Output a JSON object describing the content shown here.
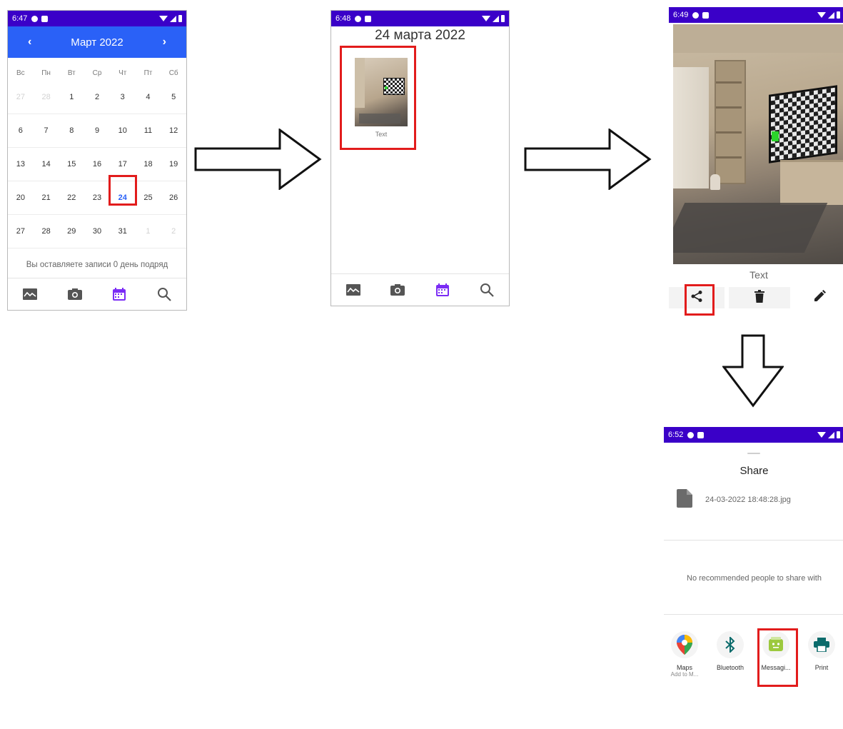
{
  "screen1": {
    "status_time": "6:47",
    "month_title": "Март  2022",
    "prev_arrow": "‹",
    "next_arrow": "›",
    "weekdays": [
      "Вс",
      "Пн",
      "Вт",
      "Ср",
      "Чт",
      "Пт",
      "Сб"
    ],
    "weeks": [
      [
        "27",
        "28",
        "1",
        "2",
        "3",
        "4",
        "5"
      ],
      [
        "6",
        "7",
        "8",
        "9",
        "10",
        "11",
        "12"
      ],
      [
        "13",
        "14",
        "15",
        "16",
        "17",
        "18",
        "19"
      ],
      [
        "20",
        "21",
        "22",
        "23",
        "24",
        "25",
        "26"
      ],
      [
        "27",
        "28",
        "29",
        "30",
        "31",
        "1",
        "2"
      ]
    ],
    "selected_day": "24",
    "streak_text": "Вы оставляете записи 0 день подряд"
  },
  "screen2": {
    "status_time": "6:48",
    "date_title": "24 марта 2022",
    "entry_caption": "Text"
  },
  "screen3": {
    "status_time": "6:49",
    "caption": "Text"
  },
  "screen4": {
    "status_time": "6:52",
    "title": "Share",
    "file_name": "24-03-2022 18:48:28.jpg",
    "no_people_text": "No recommended people to share with",
    "apps": [
      {
        "label": "Maps",
        "sublabel": "Add to M..."
      },
      {
        "label": "Bluetooth",
        "sublabel": ""
      },
      {
        "label": "Messagi...",
        "sublabel": ""
      },
      {
        "label": "Print",
        "sublabel": ""
      }
    ]
  },
  "colors": {
    "status_bar": "#3a00c8",
    "calendar_header": "#2a61f7",
    "accent_purple": "#7b2cf5",
    "highlight_red": "#e21c1c"
  },
  "icons": {
    "nav": [
      "gallery-icon",
      "camera-icon",
      "calendar-icon",
      "search-icon"
    ],
    "actions": [
      "share-icon",
      "delete-icon",
      "edit-icon"
    ]
  }
}
